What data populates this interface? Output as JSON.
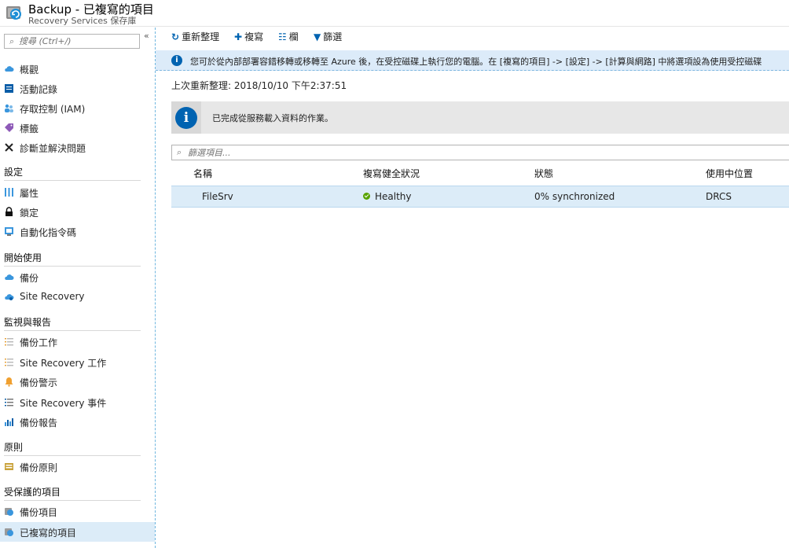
{
  "header": {
    "title": "Backup - 已複寫的項目",
    "subtitle": "Recovery Services 保存庫"
  },
  "sidebar": {
    "search_placeholder": "搜尋 (Ctrl+/)",
    "collapse": "«",
    "top_items": [
      {
        "label": "概觀",
        "icon": "cloud-icon"
      },
      {
        "label": "活動記錄",
        "icon": "log-icon"
      },
      {
        "label": "存取控制 (IAM)",
        "icon": "users-icon"
      },
      {
        "label": "標籤",
        "icon": "tag-icon"
      },
      {
        "label": "診斷並解決問題",
        "icon": "wrench-icon"
      }
    ],
    "sections": [
      {
        "title": "設定",
        "items": [
          {
            "label": "屬性",
            "icon": "properties-icon"
          },
          {
            "label": "鎖定",
            "icon": "lock-icon"
          },
          {
            "label": "自動化指令碼",
            "icon": "script-icon"
          }
        ]
      },
      {
        "title": "開始使用",
        "items": [
          {
            "label": "備份",
            "icon": "backup-cloud-icon"
          },
          {
            "label": "Site Recovery",
            "icon": "site-recovery-icon"
          }
        ]
      },
      {
        "title": "監視與報告",
        "items": [
          {
            "label": "備份工作",
            "icon": "jobs-list-icon"
          },
          {
            "label": "Site Recovery 工作",
            "icon": "jobs-list-icon"
          },
          {
            "label": "備份警示",
            "icon": "alert-bell-icon"
          },
          {
            "label": "Site Recovery 事件",
            "icon": "events-list-icon"
          },
          {
            "label": "備份報告",
            "icon": "report-chart-icon"
          }
        ]
      },
      {
        "title": "原則",
        "items": [
          {
            "label": "備份原則",
            "icon": "policy-icon"
          }
        ]
      },
      {
        "title": "受保護的項目",
        "items": [
          {
            "label": "備份項目",
            "icon": "backup-items-icon"
          },
          {
            "label": "已複寫的項目",
            "icon": "replicated-items-icon",
            "active": true
          }
        ]
      }
    ]
  },
  "toolbar": {
    "refresh": "重新整理",
    "replicate": "複寫",
    "columns": "欄",
    "filter": "篩選"
  },
  "banner": {
    "text": "您可於從內部部署容錯移轉或移轉至 Azure 後，在受控磁碟上執行您的電腦。在 [複寫的項目] -> [設定] -> [計算與網路] 中將選項設為使用受控磁碟"
  },
  "last_refreshed": "上次重新整理: 2018/10/10 下午2:37:51",
  "info": {
    "message": "已完成從服務載入資料的作業。"
  },
  "filter": {
    "placeholder": "篩選項目..."
  },
  "table": {
    "columns": [
      "名稱",
      "複寫健全狀況",
      "狀態",
      "使用中位置"
    ],
    "rows": [
      {
        "name": "FileSrv",
        "health": "Healthy",
        "status": "0% synchronized",
        "location": "DRCS"
      }
    ]
  },
  "colors": {
    "accent": "#0063b1",
    "selected": "#dcecf8",
    "healthy": "#57a300"
  }
}
